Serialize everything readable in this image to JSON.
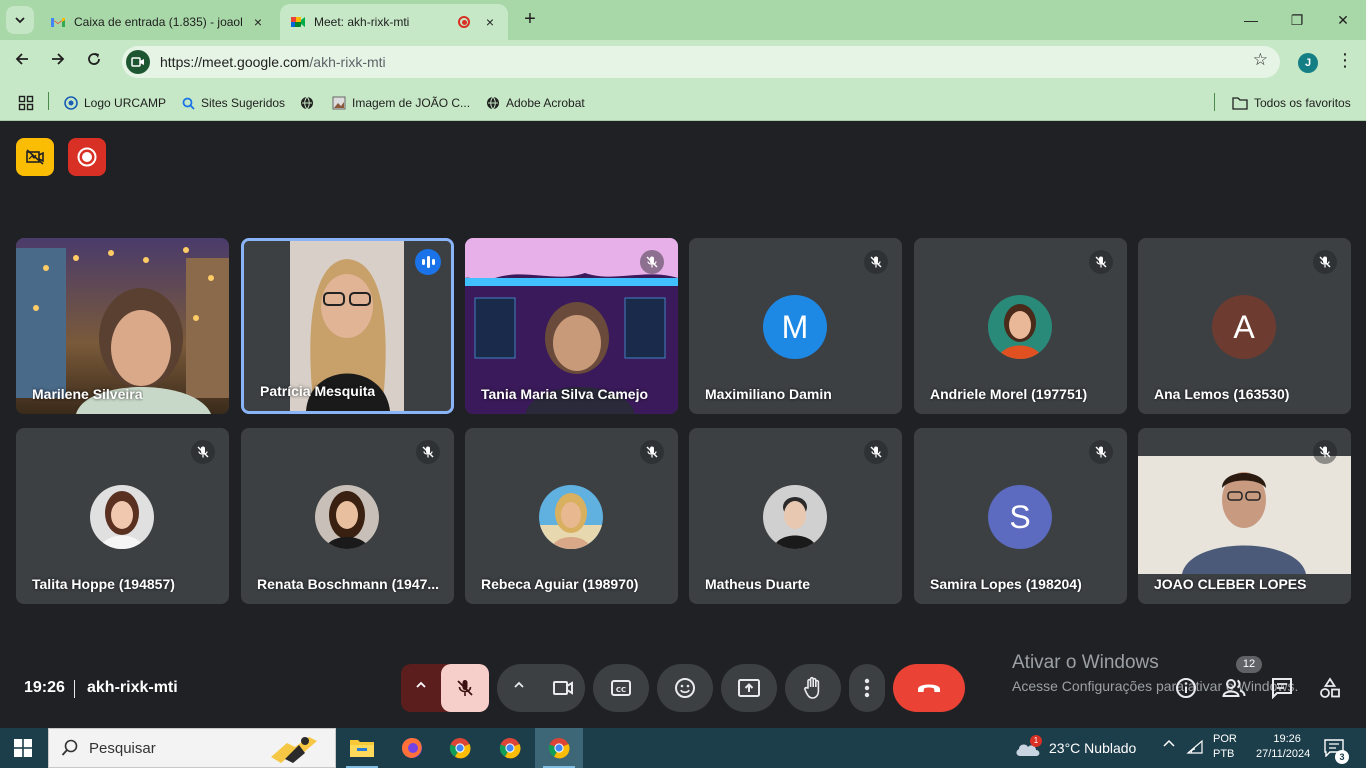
{
  "browser": {
    "tabs": [
      {
        "title": "Caixa de entrada (1.835) - joaol",
        "close": "×"
      },
      {
        "title": "Meet: akh-rixk-mti",
        "close": "×"
      }
    ],
    "new_tab": "+",
    "window": {
      "minimize": "—",
      "restore": "❐",
      "close": "✕"
    },
    "url_host": "https://meet.google.com",
    "url_path": "/akh-rixk-mti",
    "profile_initial": "J",
    "bookmarks": [
      {
        "label": "Logo URCAMP",
        "icon": "urcamp-icon"
      },
      {
        "label": "Sites Sugeridos",
        "icon": "search-icon"
      },
      {
        "label": "",
        "icon": "globe-icon"
      },
      {
        "label": "Imagem de JOÃO C...",
        "icon": "image-icon"
      },
      {
        "label": "Adobe Acrobat",
        "icon": "globe-icon"
      }
    ],
    "all_bookmarks": "Todos os favoritos"
  },
  "meet": {
    "participants": [
      {
        "name": "Marilene Silveira",
        "type": "video",
        "muted": false
      },
      {
        "name": "Patrícia Mesquita",
        "type": "video",
        "speaking": true
      },
      {
        "name": "Tania Maria Silva Camejo",
        "type": "video",
        "muted": true
      },
      {
        "name": "Maximiliano Damin",
        "type": "letter",
        "letter": "M",
        "color": "#1e88e5",
        "muted": true
      },
      {
        "name": "Andriele Morel (197751)",
        "type": "photo",
        "muted": true
      },
      {
        "name": "Ana Lemos (163530)",
        "type": "letter",
        "letter": "A",
        "color": "#6d3b30",
        "muted": true
      },
      {
        "name": "Talita Hoppe (194857)",
        "type": "photo",
        "muted": true
      },
      {
        "name": "Renata Boschmann (1947...",
        "type": "photo",
        "muted": true
      },
      {
        "name": "Rebeca Aguiar (198970)",
        "type": "photo",
        "muted": true
      },
      {
        "name": "Matheus Duarte",
        "type": "photo",
        "muted": true
      },
      {
        "name": "Samira Lopes (198204)",
        "type": "letter",
        "letter": "S",
        "color": "#5c6bc0",
        "muted": true
      },
      {
        "name": "JOAO CLEBER LOPES",
        "type": "video",
        "muted": true
      }
    ],
    "clock": "19:26",
    "meeting_code": "akh-rixk-mti",
    "people_count": "12",
    "watermark_title": "Ativar o Windows",
    "watermark_sub": "Acesse Configurações para ativar o Windows."
  },
  "taskbar": {
    "search_placeholder": "Pesquisar",
    "weather_badge": "1",
    "weather": "23°C  Nublado",
    "lang1": "POR",
    "lang2": "PTB",
    "time": "19:26",
    "date": "27/11/2024",
    "notifications": "3"
  }
}
